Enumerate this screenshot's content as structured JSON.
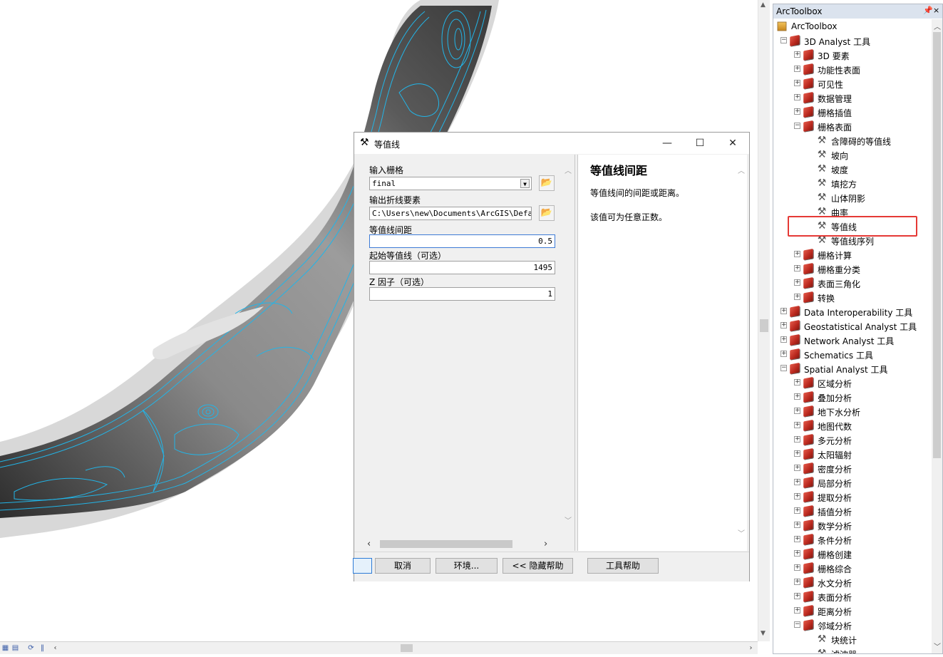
{
  "dialog": {
    "title": "等值线",
    "minimize_glyph": "—",
    "maximize_glyph": "☐",
    "close_glyph": "✕",
    "params": {
      "input_raster_label": "输入栅格",
      "input_raster_value": "final",
      "output_polyline_label": "输出折线要素",
      "output_polyline_value": "C:\\Users\\new\\Documents\\ArcGIS\\Default",
      "interval_label": "等值线间距",
      "interval_value": "0.5",
      "base_label": "起始等值线（可选）",
      "base_value": "1495",
      "z_label": "Z 因子（可选）",
      "z_value": "1"
    },
    "help": {
      "title": "等值线间距",
      "line1": "等值线间的间距或距离。",
      "line2": "该值可为任意正数。"
    },
    "buttons": {
      "ok": "",
      "cancel": "取消",
      "env": "环境...",
      "hide_help": "<< 隐藏帮助",
      "tool_help": "工具帮助"
    }
  },
  "toolbox": {
    "title": "ArcToolbox",
    "pin_glyph": "ᵖ",
    "close_glyph": "×",
    "tree": [
      {
        "label": "ArcToolbox",
        "level": 0,
        "expander": "",
        "icon": "toolbox-root-icon"
      },
      {
        "label": "3D Analyst 工具",
        "level": 1,
        "expander": "−",
        "icon": "toolbox-icon"
      },
      {
        "label": "3D 要素",
        "level": 2,
        "expander": "+",
        "icon": "toolset-icon"
      },
      {
        "label": "功能性表面",
        "level": 2,
        "expander": "+",
        "icon": "toolset-icon"
      },
      {
        "label": "可见性",
        "level": 2,
        "expander": "+",
        "icon": "toolset-icon"
      },
      {
        "label": "数据管理",
        "level": 2,
        "expander": "+",
        "icon": "toolset-icon"
      },
      {
        "label": "栅格插值",
        "level": 2,
        "expander": "+",
        "icon": "toolset-icon"
      },
      {
        "label": "栅格表面",
        "level": 2,
        "expander": "−",
        "icon": "toolset-icon"
      },
      {
        "label": "含障碍的等值线",
        "level": 3,
        "expander": "",
        "icon": "hammer-icon"
      },
      {
        "label": "坡向",
        "level": 3,
        "expander": "",
        "icon": "hammer-icon"
      },
      {
        "label": "坡度",
        "level": 3,
        "expander": "",
        "icon": "hammer-icon"
      },
      {
        "label": "填挖方",
        "level": 3,
        "expander": "",
        "icon": "hammer-icon"
      },
      {
        "label": "山体阴影",
        "level": 3,
        "expander": "",
        "icon": "hammer-icon"
      },
      {
        "label": "曲率",
        "level": 3,
        "expander": "",
        "icon": "hammer-icon"
      },
      {
        "label": "等值线",
        "level": 3,
        "expander": "",
        "icon": "hammer-icon"
      },
      {
        "label": "等值线序列",
        "level": 3,
        "expander": "",
        "icon": "hammer-icon"
      },
      {
        "label": "栅格计算",
        "level": 2,
        "expander": "+",
        "icon": "toolset-icon"
      },
      {
        "label": "栅格重分类",
        "level": 2,
        "expander": "+",
        "icon": "toolset-icon"
      },
      {
        "label": "表面三角化",
        "level": 2,
        "expander": "+",
        "icon": "toolset-icon"
      },
      {
        "label": "转换",
        "level": 2,
        "expander": "+",
        "icon": "toolset-icon"
      },
      {
        "label": "Data Interoperability 工具",
        "level": 1,
        "expander": "+",
        "icon": "toolbox-icon"
      },
      {
        "label": "Geostatistical Analyst 工具",
        "level": 1,
        "expander": "+",
        "icon": "toolbox-icon"
      },
      {
        "label": "Network Analyst 工具",
        "level": 1,
        "expander": "+",
        "icon": "toolbox-icon"
      },
      {
        "label": "Schematics 工具",
        "level": 1,
        "expander": "+",
        "icon": "toolbox-icon"
      },
      {
        "label": "Spatial Analyst 工具",
        "level": 1,
        "expander": "−",
        "icon": "toolbox-icon"
      },
      {
        "label": "区域分析",
        "level": 2,
        "expander": "+",
        "icon": "toolset-icon"
      },
      {
        "label": "叠加分析",
        "level": 2,
        "expander": "+",
        "icon": "toolset-icon"
      },
      {
        "label": "地下水分析",
        "level": 2,
        "expander": "+",
        "icon": "toolset-icon"
      },
      {
        "label": "地图代数",
        "level": 2,
        "expander": "+",
        "icon": "toolset-icon"
      },
      {
        "label": "多元分析",
        "level": 2,
        "expander": "+",
        "icon": "toolset-icon"
      },
      {
        "label": "太阳辐射",
        "level": 2,
        "expander": "+",
        "icon": "toolset-icon"
      },
      {
        "label": "密度分析",
        "level": 2,
        "expander": "+",
        "icon": "toolset-icon"
      },
      {
        "label": "局部分析",
        "level": 2,
        "expander": "+",
        "icon": "toolset-icon"
      },
      {
        "label": "提取分析",
        "level": 2,
        "expander": "+",
        "icon": "toolset-icon"
      },
      {
        "label": "插值分析",
        "level": 2,
        "expander": "+",
        "icon": "toolset-icon"
      },
      {
        "label": "数学分析",
        "level": 2,
        "expander": "+",
        "icon": "toolset-icon"
      },
      {
        "label": "条件分析",
        "level": 2,
        "expander": "+",
        "icon": "toolset-icon"
      },
      {
        "label": "栅格创建",
        "level": 2,
        "expander": "+",
        "icon": "toolset-icon"
      },
      {
        "label": "栅格综合",
        "level": 2,
        "expander": "+",
        "icon": "toolset-icon"
      },
      {
        "label": "水文分析",
        "level": 2,
        "expander": "+",
        "icon": "toolset-icon"
      },
      {
        "label": "表面分析",
        "level": 2,
        "expander": "+",
        "icon": "toolset-icon"
      },
      {
        "label": "距离分析",
        "level": 2,
        "expander": "+",
        "icon": "toolset-icon"
      },
      {
        "label": "邻域分析",
        "level": 2,
        "expander": "−",
        "icon": "toolset-icon"
      },
      {
        "label": "块统计",
        "level": 3,
        "expander": "",
        "icon": "hammer-icon"
      },
      {
        "label": "滤波器",
        "level": 3,
        "expander": "",
        "icon": "hammer-icon"
      }
    ],
    "selected_label": "等值线"
  },
  "colors": {
    "contour": "#22b5e8",
    "highlight_box": "#e53935",
    "river_dark": "#4a4a4a",
    "river_light": "#d6d6d6"
  },
  "icons": {
    "dialog_title": "hammer-icon",
    "browse": "folder-open-icon"
  }
}
